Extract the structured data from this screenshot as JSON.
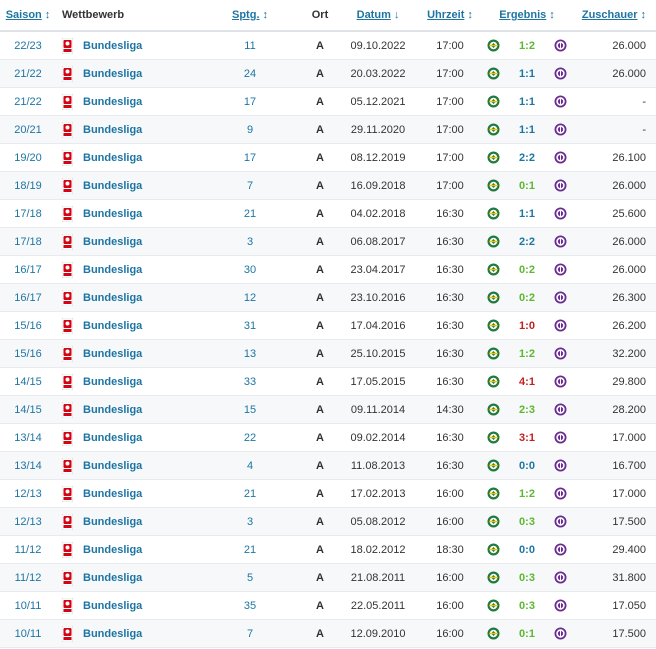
{
  "header": {
    "season": "Saison",
    "competition": "Wettbewerb",
    "matchday": "Sptg.",
    "venue": "Ort",
    "date": "Datum",
    "time": "Uhrzeit",
    "result": "Ergebnis",
    "attendance": "Zuschauer"
  },
  "colors": {
    "link": "#1d75a3",
    "win": "#5cb82e",
    "loss": "#c41e1e",
    "header_border": "#dfe3e8"
  },
  "rows": [
    {
      "season": "22/23",
      "competition": "Bundesliga",
      "matchday": "11",
      "venue": "A",
      "date": "09.10.2022",
      "time": "17:00",
      "result": "1:2",
      "outcome": "win",
      "attendance": "26.000"
    },
    {
      "season": "21/22",
      "competition": "Bundesliga",
      "matchday": "24",
      "venue": "A",
      "date": "20.03.2022",
      "time": "17:00",
      "result": "1:1",
      "outcome": "draw",
      "attendance": "26.000"
    },
    {
      "season": "21/22",
      "competition": "Bundesliga",
      "matchday": "17",
      "venue": "A",
      "date": "05.12.2021",
      "time": "17:00",
      "result": "1:1",
      "outcome": "draw",
      "attendance": "-"
    },
    {
      "season": "20/21",
      "competition": "Bundesliga",
      "matchday": "9",
      "venue": "A",
      "date": "29.11.2020",
      "time": "17:00",
      "result": "1:1",
      "outcome": "draw",
      "attendance": "-"
    },
    {
      "season": "19/20",
      "competition": "Bundesliga",
      "matchday": "17",
      "venue": "A",
      "date": "08.12.2019",
      "time": "17:00",
      "result": "2:2",
      "outcome": "draw",
      "attendance": "26.100"
    },
    {
      "season": "18/19",
      "competition": "Bundesliga",
      "matchday": "7",
      "venue": "A",
      "date": "16.09.2018",
      "time": "17:00",
      "result": "0:1",
      "outcome": "win",
      "attendance": "26.000"
    },
    {
      "season": "17/18",
      "competition": "Bundesliga",
      "matchday": "21",
      "venue": "A",
      "date": "04.02.2018",
      "time": "16:30",
      "result": "1:1",
      "outcome": "draw",
      "attendance": "25.600"
    },
    {
      "season": "17/18",
      "competition": "Bundesliga",
      "matchday": "3",
      "venue": "A",
      "date": "06.08.2017",
      "time": "16:30",
      "result": "2:2",
      "outcome": "draw",
      "attendance": "26.000"
    },
    {
      "season": "16/17",
      "competition": "Bundesliga",
      "matchday": "30",
      "venue": "A",
      "date": "23.04.2017",
      "time": "16:30",
      "result": "0:2",
      "outcome": "win",
      "attendance": "26.000"
    },
    {
      "season": "16/17",
      "competition": "Bundesliga",
      "matchday": "12",
      "venue": "A",
      "date": "23.10.2016",
      "time": "16:30",
      "result": "0:2",
      "outcome": "win",
      "attendance": "26.300"
    },
    {
      "season": "15/16",
      "competition": "Bundesliga",
      "matchday": "31",
      "venue": "A",
      "date": "17.04.2016",
      "time": "16:30",
      "result": "1:0",
      "outcome": "loss",
      "attendance": "26.200"
    },
    {
      "season": "15/16",
      "competition": "Bundesliga",
      "matchday": "13",
      "venue": "A",
      "date": "25.10.2015",
      "time": "16:30",
      "result": "1:2",
      "outcome": "win",
      "attendance": "32.200"
    },
    {
      "season": "14/15",
      "competition": "Bundesliga",
      "matchday": "33",
      "venue": "A",
      "date": "17.05.2015",
      "time": "16:30",
      "result": "4:1",
      "outcome": "loss",
      "attendance": "29.800"
    },
    {
      "season": "14/15",
      "competition": "Bundesliga",
      "matchday": "15",
      "venue": "A",
      "date": "09.11.2014",
      "time": "14:30",
      "result": "2:3",
      "outcome": "win",
      "attendance": "28.200"
    },
    {
      "season": "13/14",
      "competition": "Bundesliga",
      "matchday": "22",
      "venue": "A",
      "date": "09.02.2014",
      "time": "16:30",
      "result": "3:1",
      "outcome": "loss",
      "attendance": "17.000"
    },
    {
      "season": "13/14",
      "competition": "Bundesliga",
      "matchday": "4",
      "venue": "A",
      "date": "11.08.2013",
      "time": "16:30",
      "result": "0:0",
      "outcome": "draw",
      "attendance": "16.700"
    },
    {
      "season": "12/13",
      "competition": "Bundesliga",
      "matchday": "21",
      "venue": "A",
      "date": "17.02.2013",
      "time": "16:00",
      "result": "1:2",
      "outcome": "win",
      "attendance": "17.000"
    },
    {
      "season": "12/13",
      "competition": "Bundesliga",
      "matchday": "3",
      "venue": "A",
      "date": "05.08.2012",
      "time": "16:00",
      "result": "0:3",
      "outcome": "win",
      "attendance": "17.500"
    },
    {
      "season": "11/12",
      "competition": "Bundesliga",
      "matchday": "21",
      "venue": "A",
      "date": "18.02.2012",
      "time": "18:30",
      "result": "0:0",
      "outcome": "draw",
      "attendance": "29.400"
    },
    {
      "season": "11/12",
      "competition": "Bundesliga",
      "matchday": "5",
      "venue": "A",
      "date": "21.08.2011",
      "time": "16:00",
      "result": "0:3",
      "outcome": "win",
      "attendance": "31.800"
    },
    {
      "season": "10/11",
      "competition": "Bundesliga",
      "matchday": "35",
      "venue": "A",
      "date": "22.05.2011",
      "time": "16:00",
      "result": "0:3",
      "outcome": "win",
      "attendance": "17.050"
    },
    {
      "season": "10/11",
      "competition": "Bundesliga",
      "matchday": "7",
      "venue": "A",
      "date": "12.09.2010",
      "time": "16:00",
      "result": "0:1",
      "outcome": "win",
      "attendance": "17.500"
    }
  ]
}
